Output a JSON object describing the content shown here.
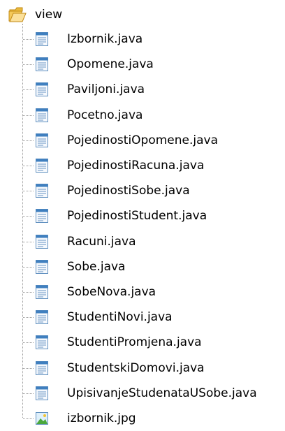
{
  "tree": {
    "root": {
      "label": "view",
      "icon": "folder-icon"
    },
    "items": [
      {
        "label": "Izbornik.java",
        "icon": "java-file-icon"
      },
      {
        "label": "Opomene.java",
        "icon": "java-file-icon"
      },
      {
        "label": "Paviljoni.java",
        "icon": "java-file-icon"
      },
      {
        "label": "Pocetno.java",
        "icon": "java-file-icon"
      },
      {
        "label": "PojedinostiOpomene.java",
        "icon": "java-file-icon"
      },
      {
        "label": "PojedinostiRacuna.java",
        "icon": "java-file-icon"
      },
      {
        "label": "PojedinostiSobe.java",
        "icon": "java-file-icon"
      },
      {
        "label": "PojedinostiStudent.java",
        "icon": "java-file-icon"
      },
      {
        "label": "Racuni.java",
        "icon": "java-file-icon"
      },
      {
        "label": "Sobe.java",
        "icon": "java-file-icon"
      },
      {
        "label": "SobeNova.java",
        "icon": "java-file-icon"
      },
      {
        "label": "StudentiNovi.java",
        "icon": "java-file-icon"
      },
      {
        "label": "StudentiPromjena.java",
        "icon": "java-file-icon"
      },
      {
        "label": "StudentskiDomovi.java",
        "icon": "java-file-icon"
      },
      {
        "label": "UpisivanjeStudenataUSobe.java",
        "icon": "java-file-icon"
      },
      {
        "label": "izbornik.jpg",
        "icon": "image-file-icon"
      }
    ]
  }
}
